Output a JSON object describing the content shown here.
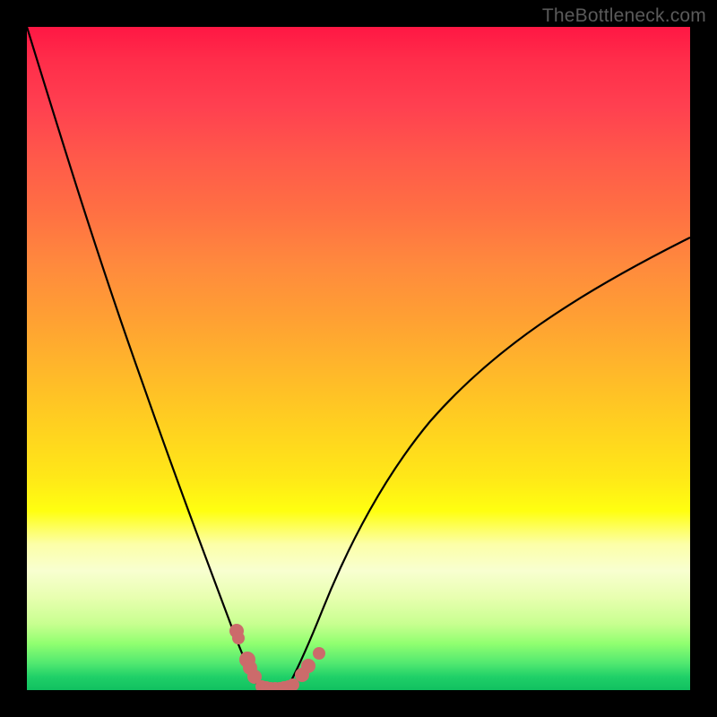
{
  "watermark": "TheBottleneck.com",
  "chart_data": {
    "type": "line",
    "title": "",
    "xlabel": "",
    "ylabel": "",
    "xlim": [
      0,
      100
    ],
    "ylim": [
      0,
      100
    ],
    "series": [
      {
        "name": "left-curve",
        "x": [
          0,
          5,
          10,
          15,
          20,
          25,
          27,
          29,
          31,
          33,
          35,
          36,
          38
        ],
        "y": [
          100,
          83,
          67,
          52,
          38,
          24,
          18,
          13,
          9,
          5,
          2,
          1,
          0
        ]
      },
      {
        "name": "right-curve",
        "x": [
          38,
          40,
          42,
          45,
          50,
          55,
          60,
          70,
          80,
          90,
          100
        ],
        "y": [
          0,
          1,
          3,
          6,
          12,
          18,
          24,
          36,
          47,
          58,
          68
        ]
      },
      {
        "name": "markers-left",
        "x": [
          31.6,
          31.9,
          33.2,
          33.7,
          34.3
        ],
        "y": [
          9.0,
          7.8,
          4.6,
          3.4,
          2.0
        ]
      },
      {
        "name": "markers-right",
        "x": [
          41.5,
          42.4,
          44.1
        ],
        "y": [
          2.3,
          3.6,
          5.6
        ]
      },
      {
        "name": "markers-valley",
        "x": [
          35.4,
          36.0,
          36.6,
          37.2,
          37.8,
          38.4,
          39.0,
          39.6,
          40.2
        ],
        "y": [
          0.6,
          0.4,
          0.3,
          0.25,
          0.25,
          0.3,
          0.4,
          0.6,
          0.9
        ]
      }
    ],
    "colors": {
      "curve": "#000000",
      "markers": "#cc6b6b",
      "gradient_top": "#ff1744",
      "gradient_mid": "#ffd020",
      "gradient_bottom": "#10c060"
    }
  }
}
